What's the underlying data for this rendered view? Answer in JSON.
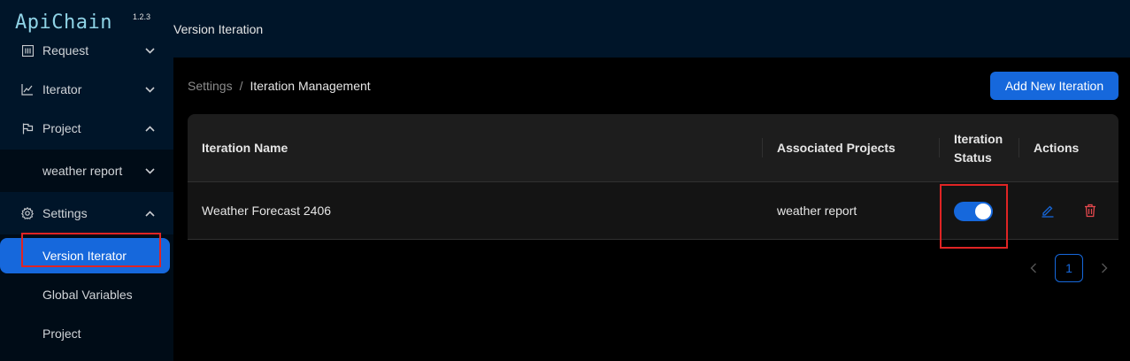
{
  "app": {
    "logo": "ApiChain",
    "version": "1.2.3"
  },
  "header": {
    "title": "Version Iteration"
  },
  "sidebar": {
    "items": [
      {
        "label": "Request",
        "icon": "request-icon"
      },
      {
        "label": "Iterator",
        "icon": "chart-line-icon"
      },
      {
        "label": "Project",
        "icon": "flag-icon"
      },
      {
        "label": "weather report"
      },
      {
        "label": "Settings",
        "icon": "gear-icon"
      },
      {
        "label": "Version Iterator"
      },
      {
        "label": "Global Variables"
      },
      {
        "label": "Project"
      }
    ]
  },
  "breadcrumb": {
    "parent": "Settings",
    "separator": "/",
    "current": "Iteration Management"
  },
  "actions": {
    "add_label": "Add New Iteration"
  },
  "table": {
    "headers": {
      "name": "Iteration Name",
      "projects": "Associated Projects",
      "status_line1": "Iteration",
      "status_line2": "Status",
      "actions": "Actions"
    },
    "rows": [
      {
        "name": "Weather Forecast 2406",
        "projects": "weather report",
        "status": "on"
      }
    ]
  },
  "pagination": {
    "current": "1"
  },
  "colors": {
    "accent": "#1668dc",
    "sidebar": "#001529",
    "danger": "#e5484d",
    "annotation": "#e02424"
  }
}
